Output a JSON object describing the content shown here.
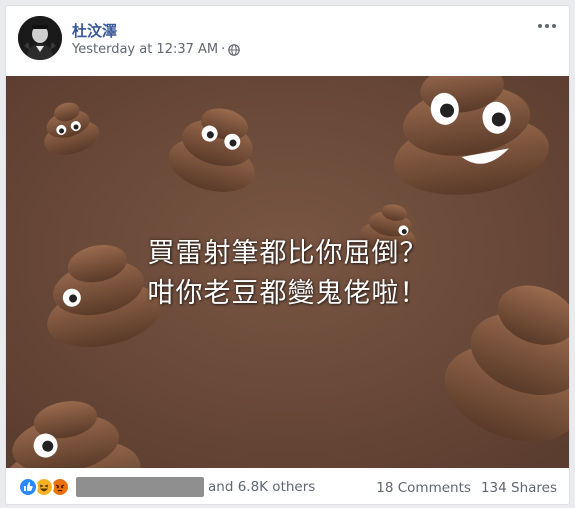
{
  "post": {
    "author": "杜汶澤",
    "timestamp": "Yesterday at 12:37 AM",
    "separator": "·",
    "privacy_icon": "globe-icon",
    "more_icon": "more-options-icon"
  },
  "media": {
    "caption_line1": "買雷射筆都比你屈倒？",
    "caption_line2": "咁你老豆都變鬼佬啦！",
    "background_color": "#6b4a39"
  },
  "footer": {
    "reactions": [
      "like-reaction-icon",
      "haha-reaction-icon",
      "angry-reaction-icon"
    ],
    "others_text": "and 6.8K others",
    "comments": "18 Comments",
    "shares": "134 Shares"
  },
  "colors": {
    "link": "#385898",
    "meta": "#616770",
    "like": "#2d88ff",
    "haha": "#f7b125",
    "angry": "#e9710f"
  }
}
